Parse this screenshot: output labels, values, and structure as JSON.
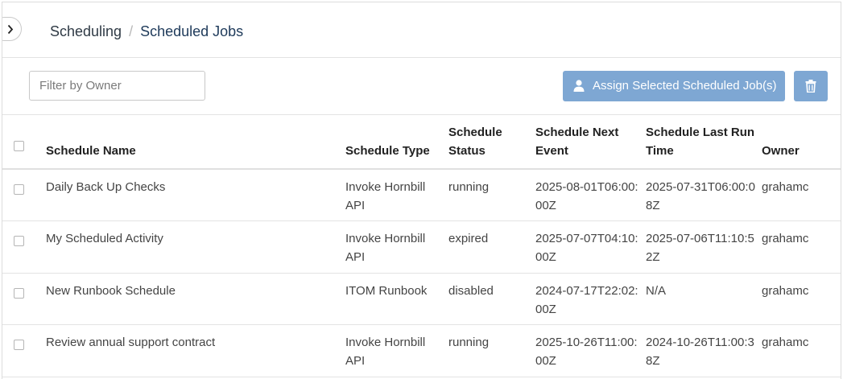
{
  "breadcrumb": {
    "parent": "Scheduling",
    "separator": "/",
    "current": "Scheduled Jobs"
  },
  "toolbar": {
    "filter_placeholder": "Filter by Owner",
    "assign_label": "Assign Selected Scheduled Job(s)",
    "accent_color": "#7ea7d3"
  },
  "table": {
    "headers": {
      "name": "Schedule Name",
      "type": "Schedule Type",
      "status": "Schedule Status",
      "next": "Schedule Next Event",
      "last": "Schedule Last Run Time",
      "owner": "Owner"
    },
    "rows": [
      {
        "name": "Daily Back Up Checks",
        "type": "Invoke Hornbill API",
        "status": "running",
        "next": "2025-08-01T06:00:00Z",
        "last": "2025-07-31T06:00:08Z",
        "owner": "grahamc"
      },
      {
        "name": "My Scheduled Activity",
        "type": "Invoke Hornbill API",
        "status": "expired",
        "next": "2025-07-07T04:10:00Z",
        "last": "2025-07-06T11:10:52Z",
        "owner": "grahamc"
      },
      {
        "name": "New Runbook Schedule",
        "type": "ITOM Runbook",
        "status": "disabled",
        "next": "2024-07-17T22:02:00Z",
        "last": "N/A",
        "owner": "grahamc"
      },
      {
        "name": "Review annual support contract",
        "type": "Invoke Hornbill API",
        "status": "running",
        "next": "2025-10-26T11:00:00Z",
        "last": "2024-10-26T11:00:38Z",
        "owner": "grahamc"
      }
    ]
  },
  "icons": {
    "sidebar_toggle": "chevron-right-icon",
    "assign": "user-icon",
    "delete": "trash-icon"
  }
}
